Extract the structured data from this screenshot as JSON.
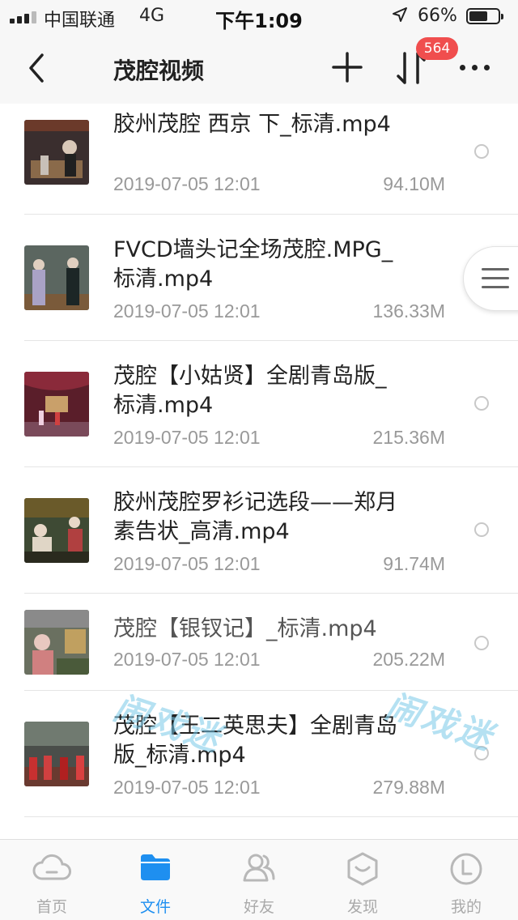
{
  "status_bar": {
    "carrier": "中国联通",
    "network": "4G",
    "time": "下午1:09",
    "battery_percent": "66%",
    "battery_level": 0.66
  },
  "nav": {
    "title": "茂腔视频",
    "badge_count": "564",
    "icons": [
      "back-icon",
      "add-icon",
      "sort-icon",
      "more-icon"
    ]
  },
  "files": [
    {
      "name": "胶州茂腔 西京 下_标清.mp4",
      "date": "2019-07-05 12:01",
      "size": "94.10M"
    },
    {
      "name": "FVCD墙头记全场茂腔.MPG_标清.mp4",
      "date": "2019-07-05 12:01",
      "size": "136.33M"
    },
    {
      "name": "茂腔【小姑贤】全剧青岛版_标清.mp4",
      "date": "2019-07-05 12:01",
      "size": "215.36M"
    },
    {
      "name": "胶州茂腔罗衫记选段——郑月素告状_高清.mp4",
      "date": "2019-07-05 12:01",
      "size": "91.74M"
    },
    {
      "name": "茂腔【银钗记】_标清.mp4",
      "date": "2019-07-05 12:01",
      "size": "205.22M"
    },
    {
      "name": "茂腔【王二英思夫】全剧青岛版_标清.mp4",
      "date": "2019-07-05 12:01",
      "size": "279.88M"
    }
  ],
  "watermark": "闹戏迷",
  "tabs": [
    {
      "label": "首页",
      "icon": "cloud-icon",
      "active": false
    },
    {
      "label": "文件",
      "icon": "folder-icon",
      "active": true
    },
    {
      "label": "好友",
      "icon": "friends-icon",
      "active": false
    },
    {
      "label": "发现",
      "icon": "discover-icon",
      "active": false
    },
    {
      "label": "我的",
      "icon": "profile-icon",
      "active": false
    }
  ],
  "colors": {
    "accent": "#1e8ff0",
    "badge": "#f04e4e",
    "text_primary": "#222222",
    "text_secondary": "#999999"
  }
}
